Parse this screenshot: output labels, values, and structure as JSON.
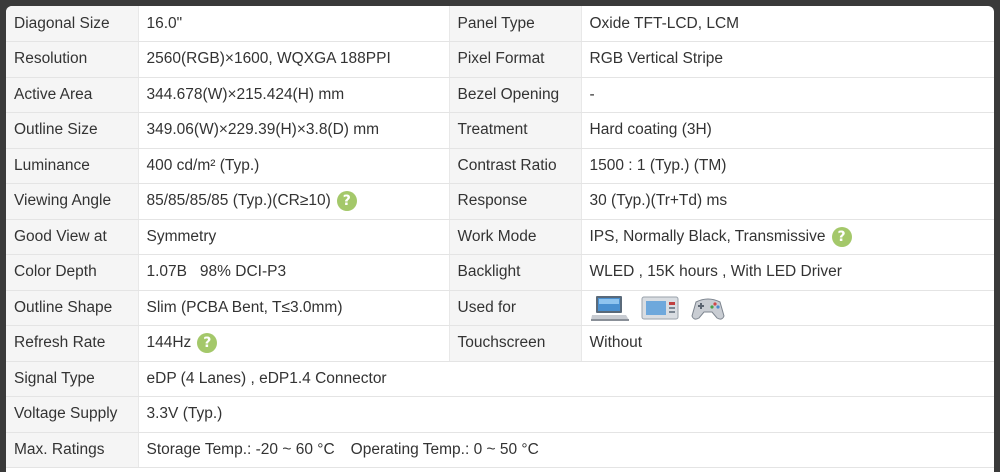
{
  "rows": [
    {
      "l1": "Diagonal Size",
      "v1": "16.0\"",
      "l2": "Panel Type",
      "v2": "Oxide TFT-LCD, LCM"
    },
    {
      "l1": "Resolution",
      "v1": "2560(RGB)×1600, WQXGA  188PPI",
      "l2": "Pixel Format",
      "v2": "RGB Vertical Stripe"
    },
    {
      "l1": "Active Area",
      "v1": "344.678(W)×215.424(H) mm",
      "l2": "Bezel Opening",
      "v2": "-"
    },
    {
      "l1": "Outline Size",
      "v1": "349.06(W)×229.39(H)×3.8(D) mm",
      "l2": "Treatment",
      "v2": "Hard coating (3H)"
    },
    {
      "l1": "Luminance",
      "v1": "400 cd/m² (Typ.)",
      "l2": "Contrast Ratio",
      "v2": "1500 : 1 (Typ.) (TM)"
    },
    {
      "l1": "Viewing Angle",
      "v1": "85/85/85/85 (Typ.)(CR≥10)",
      "l2": "Response",
      "v2": "30 (Typ.)(Tr+Td) ms"
    },
    {
      "l1": "Good View at",
      "v1": "Symmetry",
      "l2": "Work Mode",
      "v2": "IPS, Normally Black, Transmissive"
    },
    {
      "l1": "Color Depth",
      "v1": "1.07B   98% DCI-P3",
      "l2": "Backlight",
      "v2": "WLED , 15K hours , With LED Driver"
    },
    {
      "l1": "Outline Shape",
      "v1": "Slim (PCBA Bent, T≤3.0mm)",
      "l2": "Used for",
      "v2_icons": [
        "laptop-icon",
        "monitor-icon",
        "gamepad-icon"
      ]
    },
    {
      "l1": "Refresh Rate",
      "v1": "144Hz",
      "l2": "Touchscreen",
      "v2": "Without"
    },
    {
      "l1": "Signal Type",
      "v1": "eDP (4 Lanes) , eDP1.4 Connector"
    },
    {
      "l1": "Voltage Supply",
      "v1": "3.3V (Typ.)"
    },
    {
      "l1": "Max. Ratings",
      "v1a": "Storage Temp.: -20 ~ 60 °C",
      "v1b": "Operating Temp.: 0 ~ 50 °C"
    }
  ],
  "help_icon": {
    "glyph": "?",
    "color": "#a4c86a"
  }
}
